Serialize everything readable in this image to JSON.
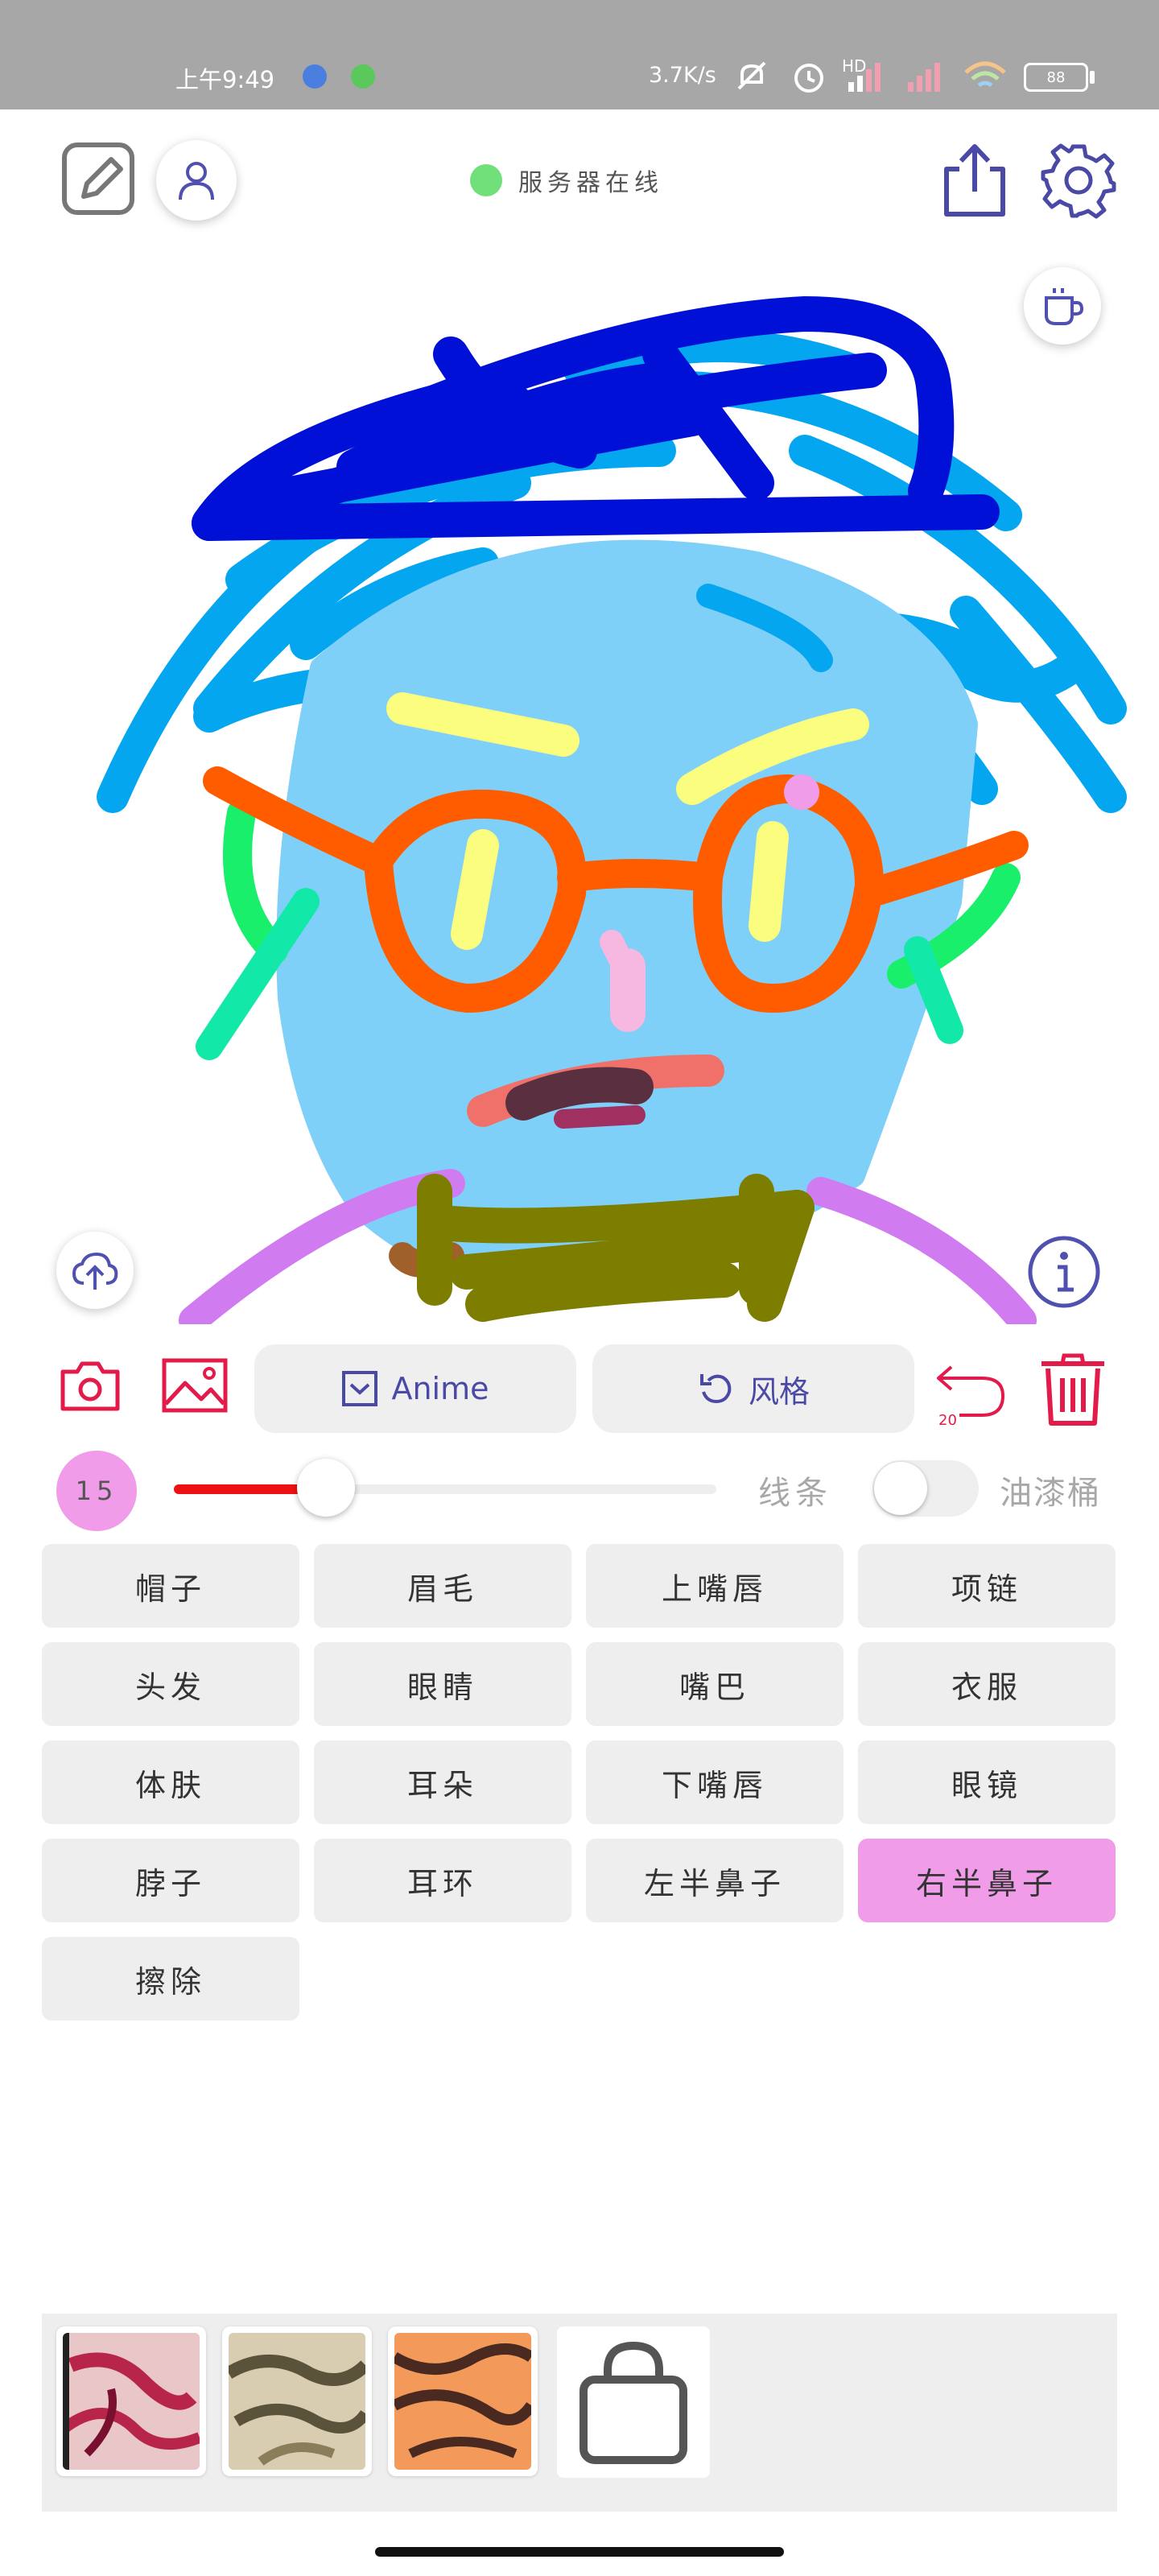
{
  "status_bar": {
    "time": "上午9:49",
    "net_speed": "3.7K/s",
    "hd_badge": "HD",
    "battery": "88"
  },
  "header": {
    "server_status": "服务器在线",
    "server_status_color": "#6fe07a"
  },
  "toolbar": {
    "anime_label": "Anime",
    "style_label": "风格",
    "undo_count": "20",
    "accent_color": "#e31b4a",
    "primary_color": "#4a4aa6"
  },
  "brush": {
    "size": "15",
    "level": 0.28,
    "color": "#ee1111",
    "mode_lines": "线条",
    "mode_bucket": "油漆桶",
    "bucket_enabled": false
  },
  "parts": [
    {
      "label": "帽子",
      "active": false
    },
    {
      "label": "眉毛",
      "active": false
    },
    {
      "label": "上嘴唇",
      "active": false
    },
    {
      "label": "项链",
      "active": false
    },
    {
      "label": "头发",
      "active": false
    },
    {
      "label": "眼睛",
      "active": false
    },
    {
      "label": "嘴巴",
      "active": false
    },
    {
      "label": "衣服",
      "active": false
    },
    {
      "label": "体肤",
      "active": false
    },
    {
      "label": "耳朵",
      "active": false
    },
    {
      "label": "下嘴唇",
      "active": false
    },
    {
      "label": "眼镜",
      "active": false
    },
    {
      "label": "脖子",
      "active": false
    },
    {
      "label": "耳环",
      "active": false
    },
    {
      "label": "左半鼻子",
      "active": false
    },
    {
      "label": "右半鼻子",
      "active": true
    },
    {
      "label": "擦除",
      "active": false
    }
  ],
  "active_part_color": "#f09ce8",
  "icons": {
    "edit": "edit-square-icon",
    "user": "user-icon",
    "share": "share-icon",
    "settings": "gear-icon",
    "coffee": "coffee-cup-icon",
    "upload": "cloud-upload-icon",
    "info": "info-icon",
    "camera": "camera-icon",
    "gallery": "image-icon",
    "undo": "undo-icon",
    "trash": "trash-icon",
    "shop": "shopping-bag-icon"
  }
}
